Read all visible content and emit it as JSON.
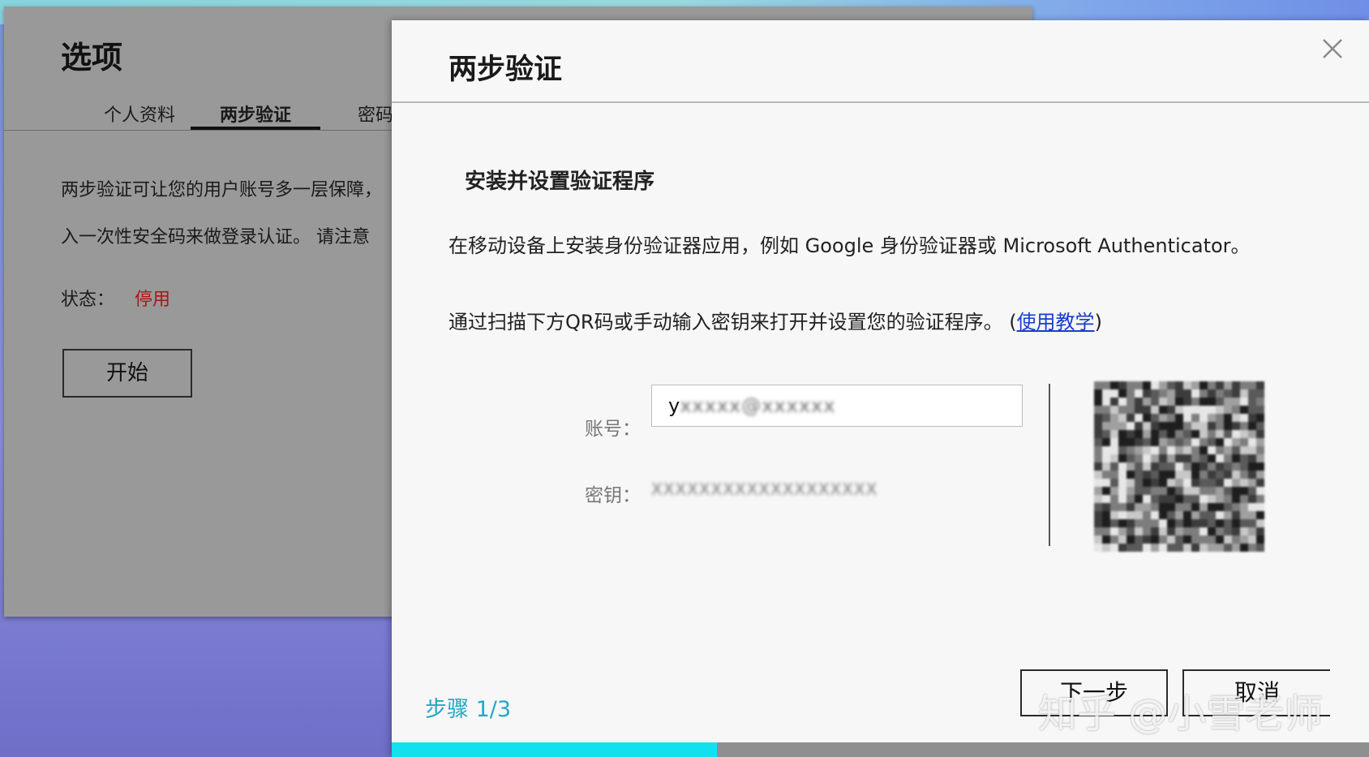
{
  "background_window": {
    "title": "选项",
    "tabs": [
      "个人资料",
      "两步验证",
      "密码设置"
    ],
    "active_tab": 1,
    "description_line1": "两步验证可让您的用户账号多一层保障，",
    "description_line2": "入一次性安全码来做登录认证。 请注意",
    "status_label": "状态：",
    "status_value": "停用",
    "start_button": "开始"
  },
  "dialog": {
    "title": "两步验证",
    "close_icon": "close-icon",
    "subtitle": "安装并设置验证程序",
    "paragraph1": "在移动设备上安装身份验证器应用，例如 Google 身份验证器或 Microsoft Authenticator。",
    "paragraph2_text": "通过扫描下方QR码或手动输入密钥来打开并设置您的验证程序。 (",
    "paragraph2_link": "使用教学",
    "paragraph2_end": ")",
    "account_label": "账号：",
    "account_value_prefix": "y",
    "account_value_blurred": "xxxxx@xxxxxx",
    "key_label": "密钥：",
    "key_value_blurred": "XXXXXXXXXXXXXXXXXXX",
    "step_label": "步骤 1/3",
    "next_button": "下一步",
    "cancel_button": "取消",
    "progress_fraction": 0.333
  },
  "watermark": "知乎 @小雪老师",
  "colors": {
    "status_disabled": "#b01414",
    "step_accent": "#22a8c6",
    "progress_fill": "#12e0ee",
    "link": "#1a3ccf"
  }
}
